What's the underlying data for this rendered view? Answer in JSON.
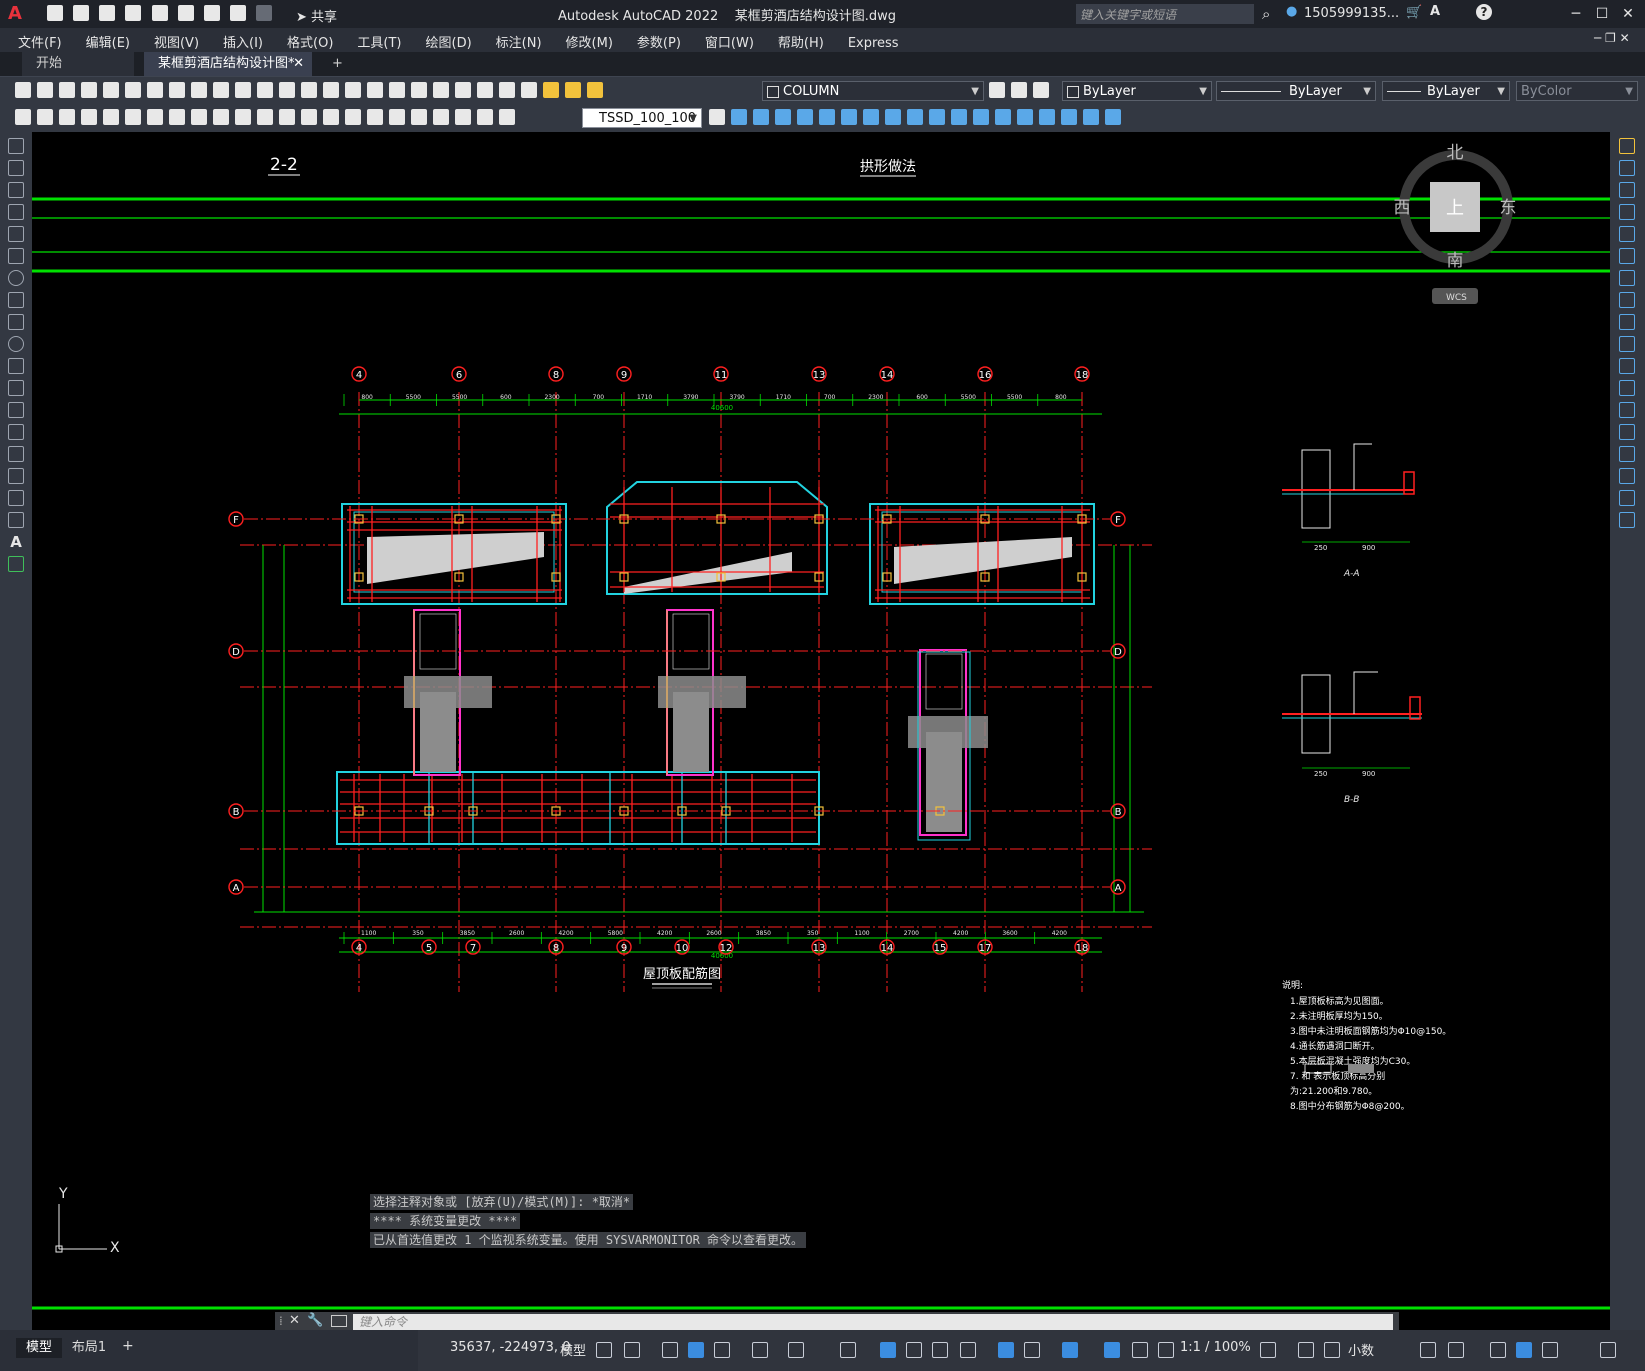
{
  "window": {
    "app_logo": "A",
    "share_label": "共享",
    "title": "Autodesk AutoCAD 2022    某框剪酒店结构设计图.dwg",
    "search_placeholder": "键入关键字或短语",
    "user": "1505999135...",
    "minimize": "─",
    "maximize": "☐",
    "close": "✕"
  },
  "menu": [
    "文件(F)",
    "编辑(E)",
    "视图(V)",
    "插入(I)",
    "格式(O)",
    "工具(T)",
    "绘图(D)",
    "标注(N)",
    "修改(M)",
    "参数(P)",
    "窗口(W)",
    "帮助(H)",
    "Express"
  ],
  "tabs": {
    "start": "开始",
    "active": "某框剪酒店结构设计图*",
    "add": "+"
  },
  "properties": {
    "layer": "COLUMN",
    "color": "ByLayer",
    "linetype": "ByLayer",
    "lineweight": "ByLayer",
    "plotstyle": "ByColor",
    "dimstyle": "TSSD_100_100"
  },
  "viewcube": {
    "north": "北",
    "south": "南",
    "east": "东",
    "west": "西",
    "top": "上",
    "wcs": "WCS"
  },
  "drawing": {
    "section_label": "2-2",
    "heading_top": "拱形做法",
    "plan_title": "屋顶板配筋图",
    "overall_dim": "40600",
    "section_a": "A-A",
    "section_b": "B-B",
    "sec_dims_a": [
      "250",
      "900"
    ],
    "sec_dims_b": [
      "250",
      "900"
    ],
    "top_axes": [
      "4",
      "6",
      "8",
      "9",
      "11",
      "13",
      "14",
      "16",
      "18"
    ],
    "bottom_axes": [
      "4",
      "5",
      "7",
      "8",
      "9",
      "10",
      "12",
      "13",
      "14",
      "15",
      "17",
      "18"
    ],
    "row_axes": [
      "F",
      "D",
      "B",
      "A"
    ],
    "top_dims": [
      "800",
      "5500",
      "5500",
      "600",
      "2300",
      "700",
      "1710",
      "3790",
      "3790",
      "1710",
      "700",
      "2300",
      "600",
      "5500",
      "5500",
      "800"
    ],
    "bottom_dims": [
      "1100",
      "350",
      "3850",
      "2600",
      "4200",
      "5800",
      "4200",
      "2600",
      "3850",
      "350",
      "1100",
      "2700",
      "4200",
      "3600",
      "4200"
    ],
    "notes_title": "说明:",
    "notes": [
      "1.屋顶板标高为见图面。",
      "2.未注明板厚均为150。",
      "3.图中未注明板面钢筋均为Φ10@150。",
      "4.通长筋遇洞口断开。",
      "5.本层板混凝土强度均为C30。",
      "7.            和            表示板顶标高分别",
      "   为:21.200和9.780。",
      "8.图中分布钢筋为Φ8@200。"
    ]
  },
  "ucs": {
    "y": "Y",
    "x": "X"
  },
  "command": {
    "history": [
      "选择注释对象或 [放弃(U)/模式(M)]: *取消*",
      "**** 系统变量更改 ****",
      "已从首选值更改 1 个监视系统变量。使用 SYSVARMONITOR 命令以查看更改。"
    ],
    "placeholder": "键入命令"
  },
  "status": {
    "layout_tabs": [
      "模型",
      "布局1"
    ],
    "add": "+",
    "coords": "35637, -224973, 0",
    "model": "模型",
    "scale": "1:1 / 100%",
    "units": "小数"
  },
  "colors": {
    "canvas": "#000000",
    "green": "#00e000",
    "red": "#ff2020",
    "cyan": "#22d3e0",
    "magenta": "#ff33cc",
    "accent": "#3b8de0"
  }
}
